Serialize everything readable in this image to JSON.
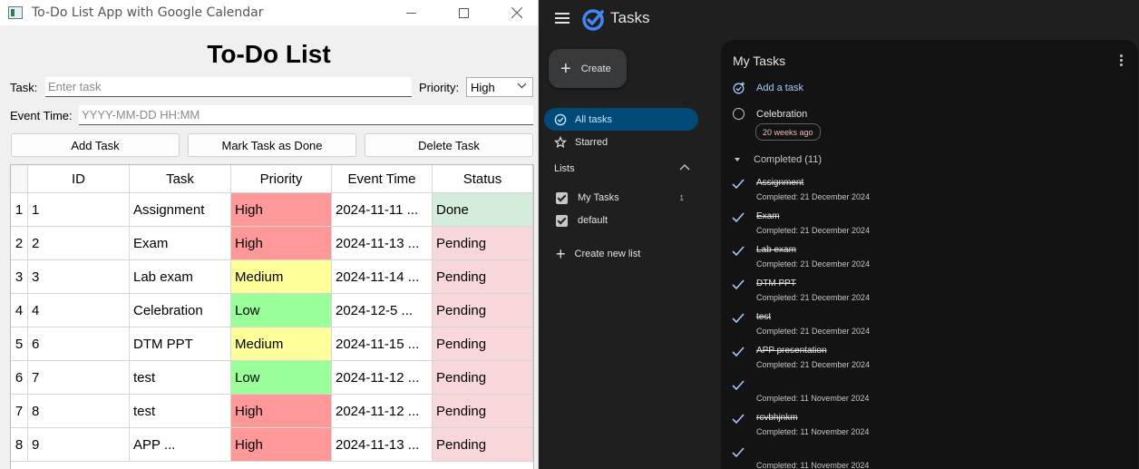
{
  "app": {
    "window_title": "To-Do List App with Google Calendar",
    "heading": "To-Do List",
    "task_label": "Task:",
    "task_placeholder": "Enter task",
    "priority_label": "Priority:",
    "priority_value": "High",
    "event_time_label": "Event Time:",
    "event_time_placeholder": "YYYY-MM-DD HH:MM",
    "buttons": {
      "add": "Add Task",
      "mark_done": "Mark Task as Done",
      "delete": "Delete Task"
    },
    "columns": [
      "ID",
      "Task",
      "Priority",
      "Event Time",
      "Status"
    ],
    "rows": [
      {
        "num": "1",
        "id": "1",
        "task": "Assignment",
        "priority": "High",
        "event": "2024-11-11 ...",
        "status": "Done"
      },
      {
        "num": "2",
        "id": "2",
        "task": "Exam",
        "priority": "High",
        "event": "2024-11-13 ...",
        "status": "Pending"
      },
      {
        "num": "3",
        "id": "3",
        "task": "Lab exam",
        "priority": "Medium",
        "event": "2024-11-14 ...",
        "status": "Pending"
      },
      {
        "num": "4",
        "id": "4",
        "task": "Celebration",
        "priority": "Low",
        "event": "2024-12-5 ...",
        "status": "Pending"
      },
      {
        "num": "5",
        "id": "6",
        "task": "DTM PPT",
        "priority": "Medium",
        "event": "2024-11-15 ...",
        "status": "Pending"
      },
      {
        "num": "6",
        "id": "7",
        "task": "test",
        "priority": "Low",
        "event": "2024-11-12 ...",
        "status": "Pending"
      },
      {
        "num": "7",
        "id": "8",
        "task": "test",
        "priority": "High",
        "event": "2024-11-12 ...",
        "status": "Pending"
      },
      {
        "num": "8",
        "id": "9",
        "task": "APP ...",
        "priority": "High",
        "event": "2024-11-13 ...",
        "status": "Pending"
      }
    ],
    "colors": {
      "High": "#ff9999",
      "Medium": "#ffff99",
      "Low": "#99ff99",
      "Done": "#d4edda",
      "Pending": "#f8d7da"
    }
  },
  "tasks": {
    "brand": "Tasks",
    "create_label": "Create",
    "nav": {
      "all_tasks": "All tasks",
      "starred": "Starred"
    },
    "lists_header": "Lists",
    "lists": [
      {
        "name": "My Tasks",
        "count": "1"
      },
      {
        "name": "default",
        "count": ""
      }
    ],
    "create_new_list": "Create new list",
    "panel_title": "My Tasks",
    "add_task": "Add a task",
    "pending_task": {
      "title": "Celebration",
      "due_chip": "20 weeks ago"
    },
    "completed_header": "Completed (11)",
    "completed": [
      {
        "title": "Assignment",
        "date": "Completed: 21 December 2024"
      },
      {
        "title": "Exam",
        "date": "Completed: 21 December 2024"
      },
      {
        "title": "Lab exam",
        "date": "Completed: 21 December 2024"
      },
      {
        "title": "DTM PPT",
        "date": "Completed: 21 December 2024"
      },
      {
        "title": "test",
        "date": "Completed: 21 December 2024"
      },
      {
        "title": "APP presentation",
        "date": "Completed: 21 December 2024"
      },
      {
        "title": "",
        "date": "Completed: 11 November 2024"
      },
      {
        "title": "rcvbhjnkm",
        "date": "Completed: 11 November 2024"
      },
      {
        "title": "",
        "date": "Completed: 11 November 2024"
      }
    ],
    "accent": "#a8c7fa"
  }
}
